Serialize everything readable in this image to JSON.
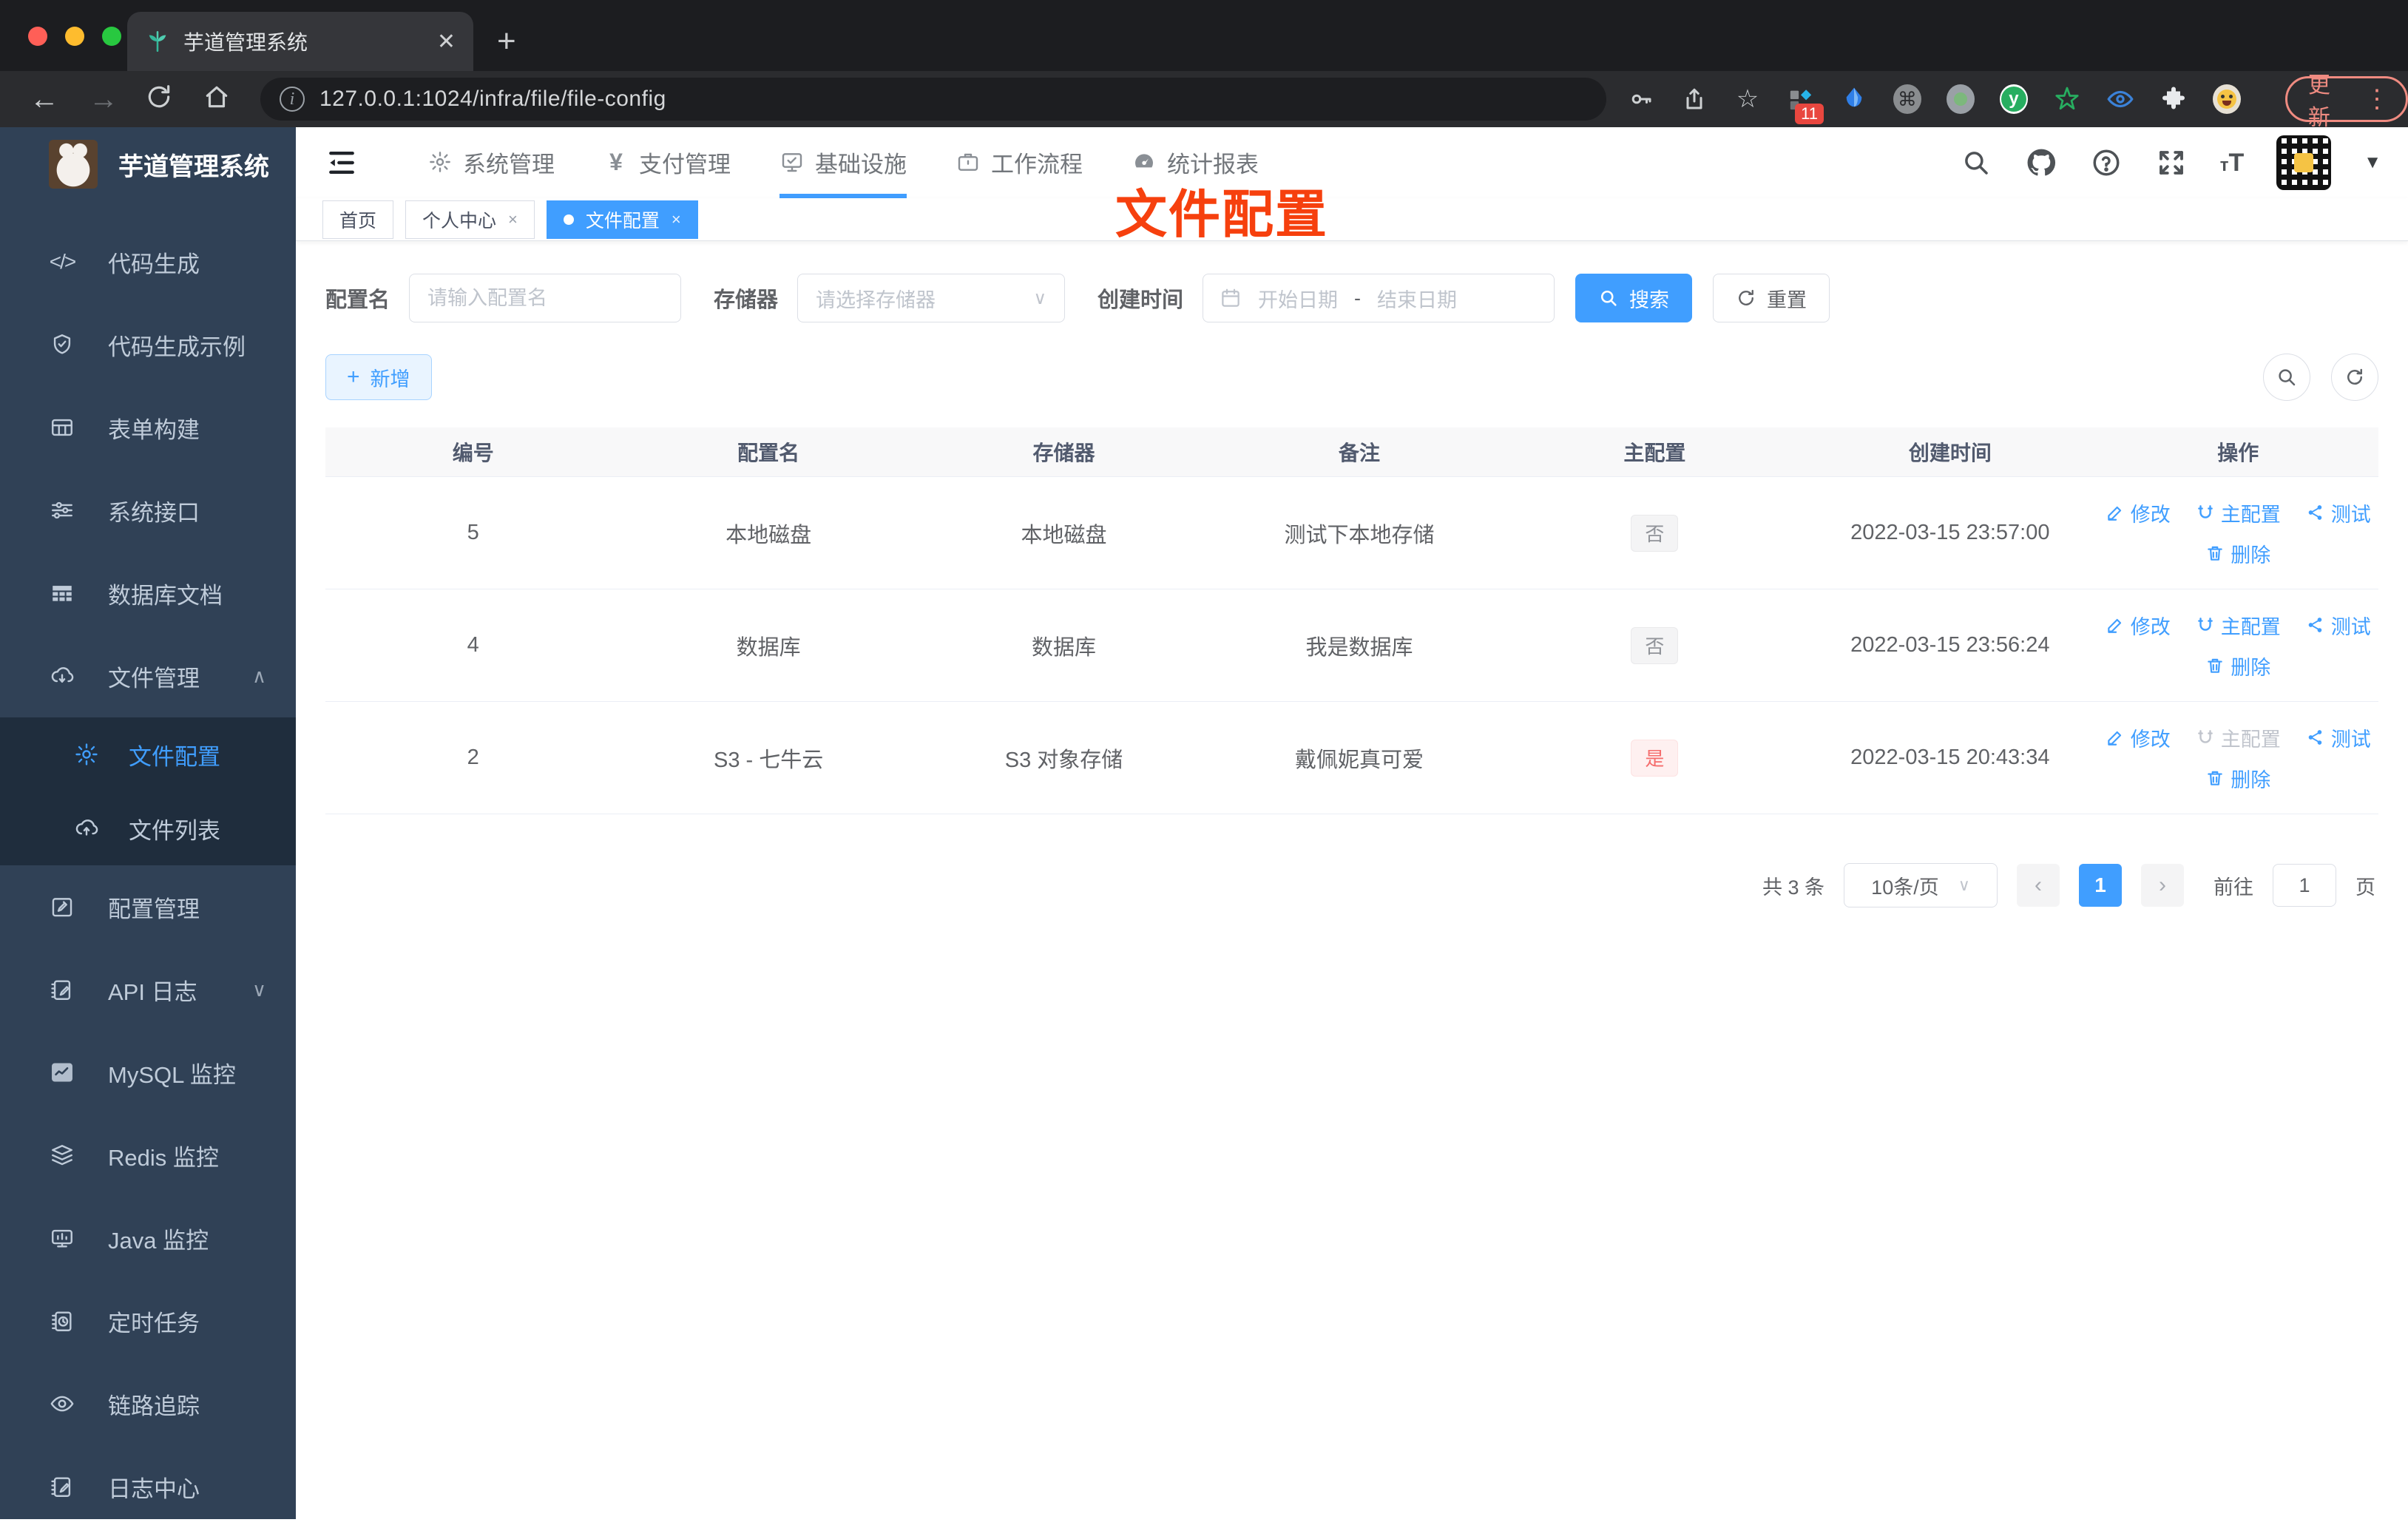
{
  "browser": {
    "tab_title": "芋道管理系统",
    "url": "127.0.0.1:1024/infra/file/file-config",
    "update_label": "更新",
    "extension_badge": "11"
  },
  "sidebar": {
    "logo_title": "芋道管理系统",
    "items_top": [
      {
        "label": "代码生成",
        "icon": "code-icon"
      },
      {
        "label": "代码生成示例",
        "icon": "shield-check-icon"
      },
      {
        "label": "表单构建",
        "icon": "form-grid-icon"
      },
      {
        "label": "系统接口",
        "icon": "sliders-icon"
      },
      {
        "label": "数据库文档",
        "icon": "database-table-icon"
      },
      {
        "label": "文件管理",
        "icon": "cloud-download-icon",
        "chevron": "up"
      }
    ],
    "submenu": [
      {
        "label": "文件配置",
        "icon": "gear-icon",
        "active": true
      },
      {
        "label": "文件列表",
        "icon": "cloud-upload-icon",
        "active": false
      }
    ],
    "items_bottom": [
      {
        "label": "配置管理",
        "icon": "edit-square-icon"
      },
      {
        "label": "API 日志",
        "icon": "log-edit-icon",
        "chevron": "down"
      },
      {
        "label": "MySQL 监控",
        "icon": "chart-monitor-icon"
      },
      {
        "label": "Redis 监控",
        "icon": "layers-icon"
      },
      {
        "label": "Java 监控",
        "icon": "monitor-icon"
      },
      {
        "label": "定时任务",
        "icon": "schedule-icon"
      },
      {
        "label": "链路追踪",
        "icon": "eye-icon"
      },
      {
        "label": "日志中心",
        "icon": "log-edit-icon"
      }
    ]
  },
  "topnav": {
    "items": [
      {
        "label": "系统管理",
        "icon": "gear-icon"
      },
      {
        "label": "支付管理",
        "icon": "yen-icon"
      },
      {
        "label": "基础设施",
        "icon": "monitor-check-icon",
        "active": true
      },
      {
        "label": "工作流程",
        "icon": "briefcase-icon"
      },
      {
        "label": "统计报表",
        "icon": "dashboard-icon"
      }
    ]
  },
  "tags": {
    "items": [
      {
        "label": "首页",
        "closable": false,
        "active": false
      },
      {
        "label": "个人中心",
        "closable": true,
        "active": false
      },
      {
        "label": "文件配置",
        "closable": true,
        "active": true
      }
    ],
    "close_glyph": "×"
  },
  "overlay_title": "文件配置",
  "filters": {
    "name_label": "配置名",
    "name_placeholder": "请输入配置名",
    "storage_label": "存储器",
    "storage_placeholder": "请选择存储器",
    "date_label": "创建时间",
    "date_start_placeholder": "开始日期",
    "date_separator": "-",
    "date_end_placeholder": "结束日期",
    "search_label": "搜索",
    "reset_label": "重置",
    "add_label": "新增"
  },
  "table": {
    "headers": [
      "编号",
      "配置名",
      "存储器",
      "备注",
      "主配置",
      "创建时间",
      "操作"
    ],
    "actions": {
      "edit": "修改",
      "master": "主配置",
      "test": "测试",
      "delete": "删除"
    },
    "rows": [
      {
        "id": "5",
        "name": "本地磁盘",
        "storage": "本地磁盘",
        "remark": "测试下本地存储",
        "primary": "否",
        "created": "2022-03-15 23:57:00"
      },
      {
        "id": "4",
        "name": "数据库",
        "storage": "数据库",
        "remark": "我是数据库",
        "primary": "否",
        "created": "2022-03-15 23:56:24"
      },
      {
        "id": "2",
        "name": "S3 - 七牛云",
        "storage": "S3 对象存储",
        "remark": "戴佩妮真可爱",
        "primary": "是",
        "created": "2022-03-15 20:43:34"
      }
    ]
  },
  "pagination": {
    "total_text": "共 3 条",
    "page_size": "10条/页",
    "prev_glyph": "‹",
    "current_page": "1",
    "next_glyph": "›",
    "goto_label": "前往",
    "goto_value": "1",
    "goto_unit": "页"
  },
  "colors": {
    "accent": "#409eff",
    "overlay_red": "#f6400e",
    "danger": "#f56c6c"
  }
}
